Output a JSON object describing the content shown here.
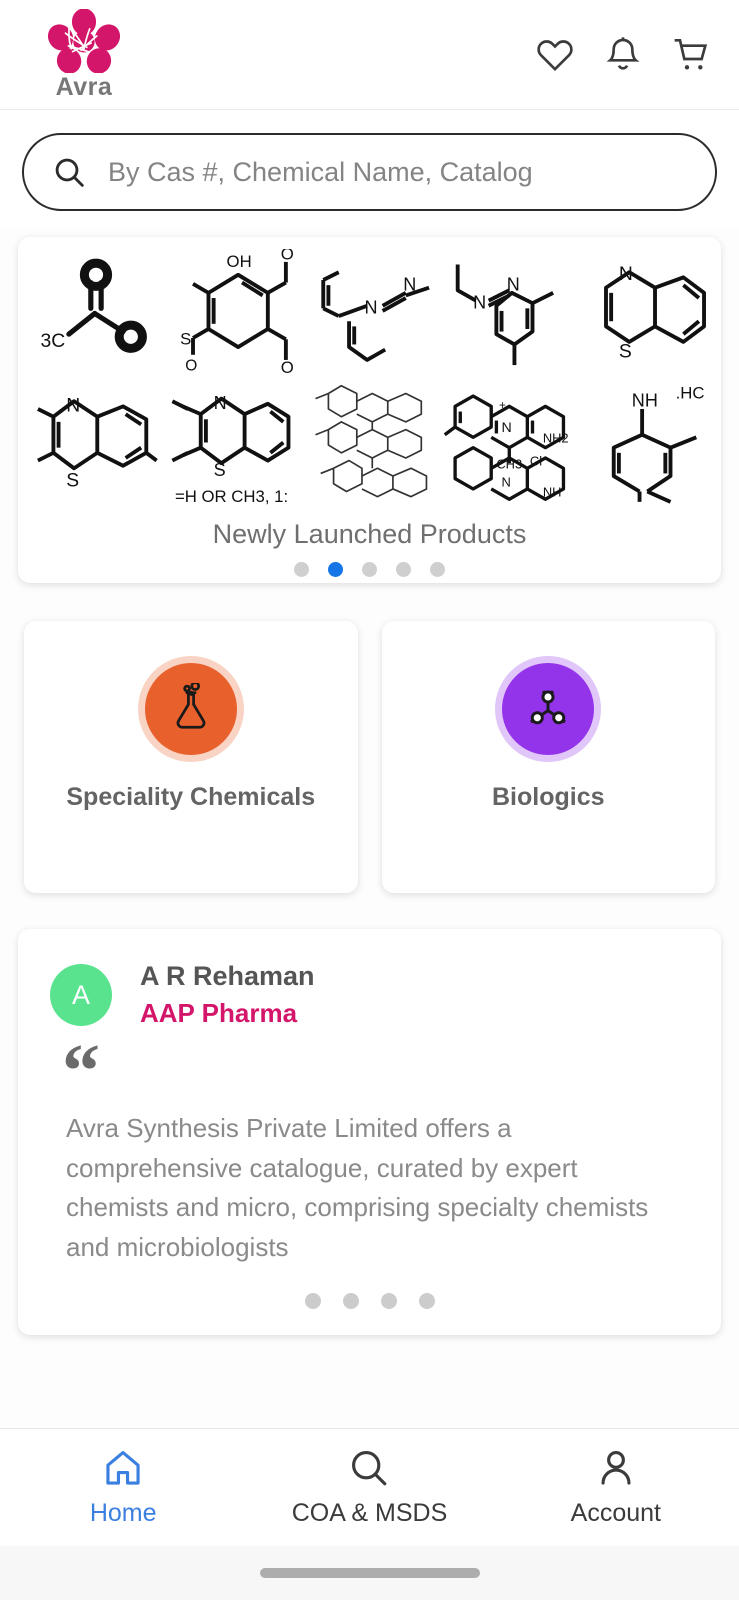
{
  "header": {
    "logo_text": "Avra",
    "logo_color": "#d4166b",
    "icons": [
      {
        "name": "wishlist-icon",
        "label": "Wishlist"
      },
      {
        "name": "notifications-icon",
        "label": "Notifications"
      },
      {
        "name": "cart-icon",
        "label": "Cart"
      }
    ]
  },
  "search": {
    "placeholder": "By Cas #, Chemical Name, Catalog",
    "value": ""
  },
  "carousel": {
    "caption": "Newly Launched Products",
    "structure_note": "=H OR CH3, 1:",
    "labels": {
      "l_oh": "OH",
      "l_o": "O",
      "l_n": "N",
      "l_s": "S",
      "l_nh": "NH",
      "l_nh2": "NH2",
      "l_ch3": "CH3",
      "l_cl": "Cl",
      "l_hc": "HC",
      "l_c3": "3C"
    },
    "dots": [
      {
        "active": false
      },
      {
        "active": true
      },
      {
        "active": false
      },
      {
        "active": false
      },
      {
        "active": false
      }
    ]
  },
  "categories": [
    {
      "label": "Speciality Chemicals",
      "icon": "flask-icon",
      "color": "#e8602c"
    },
    {
      "label": "Biologics",
      "icon": "molecule-icon",
      "color": "#9333ea"
    }
  ],
  "testimonial": {
    "avatar_initial": "A",
    "avatar_color": "#5ae38f",
    "name": "A R Rehaman",
    "company": "AAP Pharma",
    "company_color": "#d4166b",
    "quote_glyph": "“",
    "body": "Avra Synthesis Private Limited offers a comprehensive catalogue, curated by expert chemists and micro, comprising specialty chemists and microbiologists",
    "dots": [
      {
        "active": false
      },
      {
        "active": false
      },
      {
        "active": false
      },
      {
        "active": false
      }
    ]
  },
  "bottom_nav": {
    "items": [
      {
        "label": "Home",
        "icon": "home-icon",
        "active": true
      },
      {
        "label": "COA & MSDS",
        "icon": "search-icon",
        "active": false
      },
      {
        "label": "Account",
        "icon": "person-icon",
        "active": false
      }
    ],
    "active_color": "#3b7fe0"
  }
}
